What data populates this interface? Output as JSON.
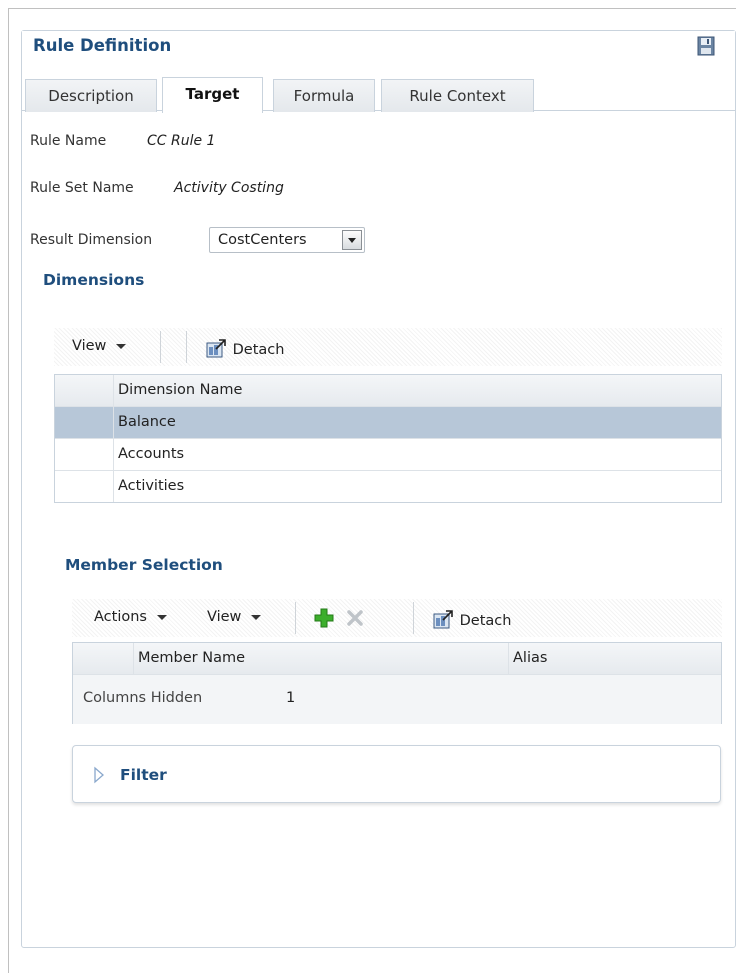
{
  "panel": {
    "title": "Rule Definition",
    "save_icon": "floppy-disk-icon"
  },
  "tabs": [
    {
      "label": "Description",
      "active": false
    },
    {
      "label": "Target",
      "active": true
    },
    {
      "label": "Formula",
      "active": false
    },
    {
      "label": "Rule Context",
      "active": false
    }
  ],
  "fields": {
    "rule_name_label": "Rule Name",
    "rule_name_value": "CC Rule 1",
    "rule_set_label": "Rule Set Name",
    "rule_set_value": "Activity Costing",
    "result_dimension_label": "Result Dimension",
    "result_dimension_value": "CostCenters"
  },
  "dimensions": {
    "title": "Dimensions",
    "toolbar": {
      "view": "View",
      "detach": "Detach"
    },
    "column": "Dimension Name",
    "rows": [
      "Balance",
      "Accounts",
      "Activities"
    ],
    "selected_row": "Balance"
  },
  "member_selection": {
    "title": "Member Selection",
    "toolbar": {
      "actions": "Actions",
      "view": "View",
      "detach": "Detach"
    },
    "columns": [
      "Member Name",
      "Alias"
    ],
    "columns_hidden_label": "Columns Hidden",
    "columns_hidden_value": "1"
  },
  "filter": {
    "label": "Filter"
  },
  "colors": {
    "title": "#1f4e7d",
    "selected_row": "#b7c7d8",
    "add_icon": "#3cae2c"
  }
}
